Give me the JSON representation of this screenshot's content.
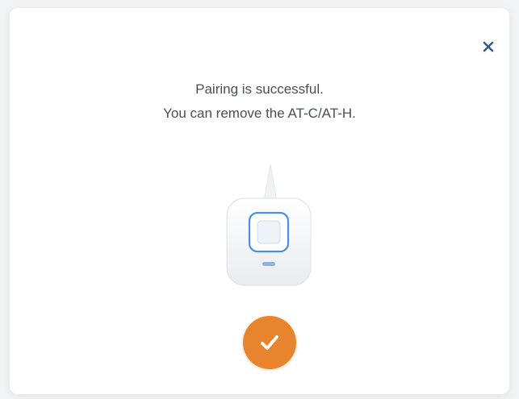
{
  "dialog": {
    "message_line1": "Pairing is successful.",
    "message_line2": "You can remove the AT-C/AT-H.",
    "close_icon": "close-icon",
    "illustration_icon": "pairing-device-icon",
    "status_icon": "checkmark-icon"
  },
  "colors": {
    "accent": "#e8842e",
    "close": "#3a5a8c",
    "device_frame": "#4a90e2",
    "text": "#4a4f57"
  }
}
